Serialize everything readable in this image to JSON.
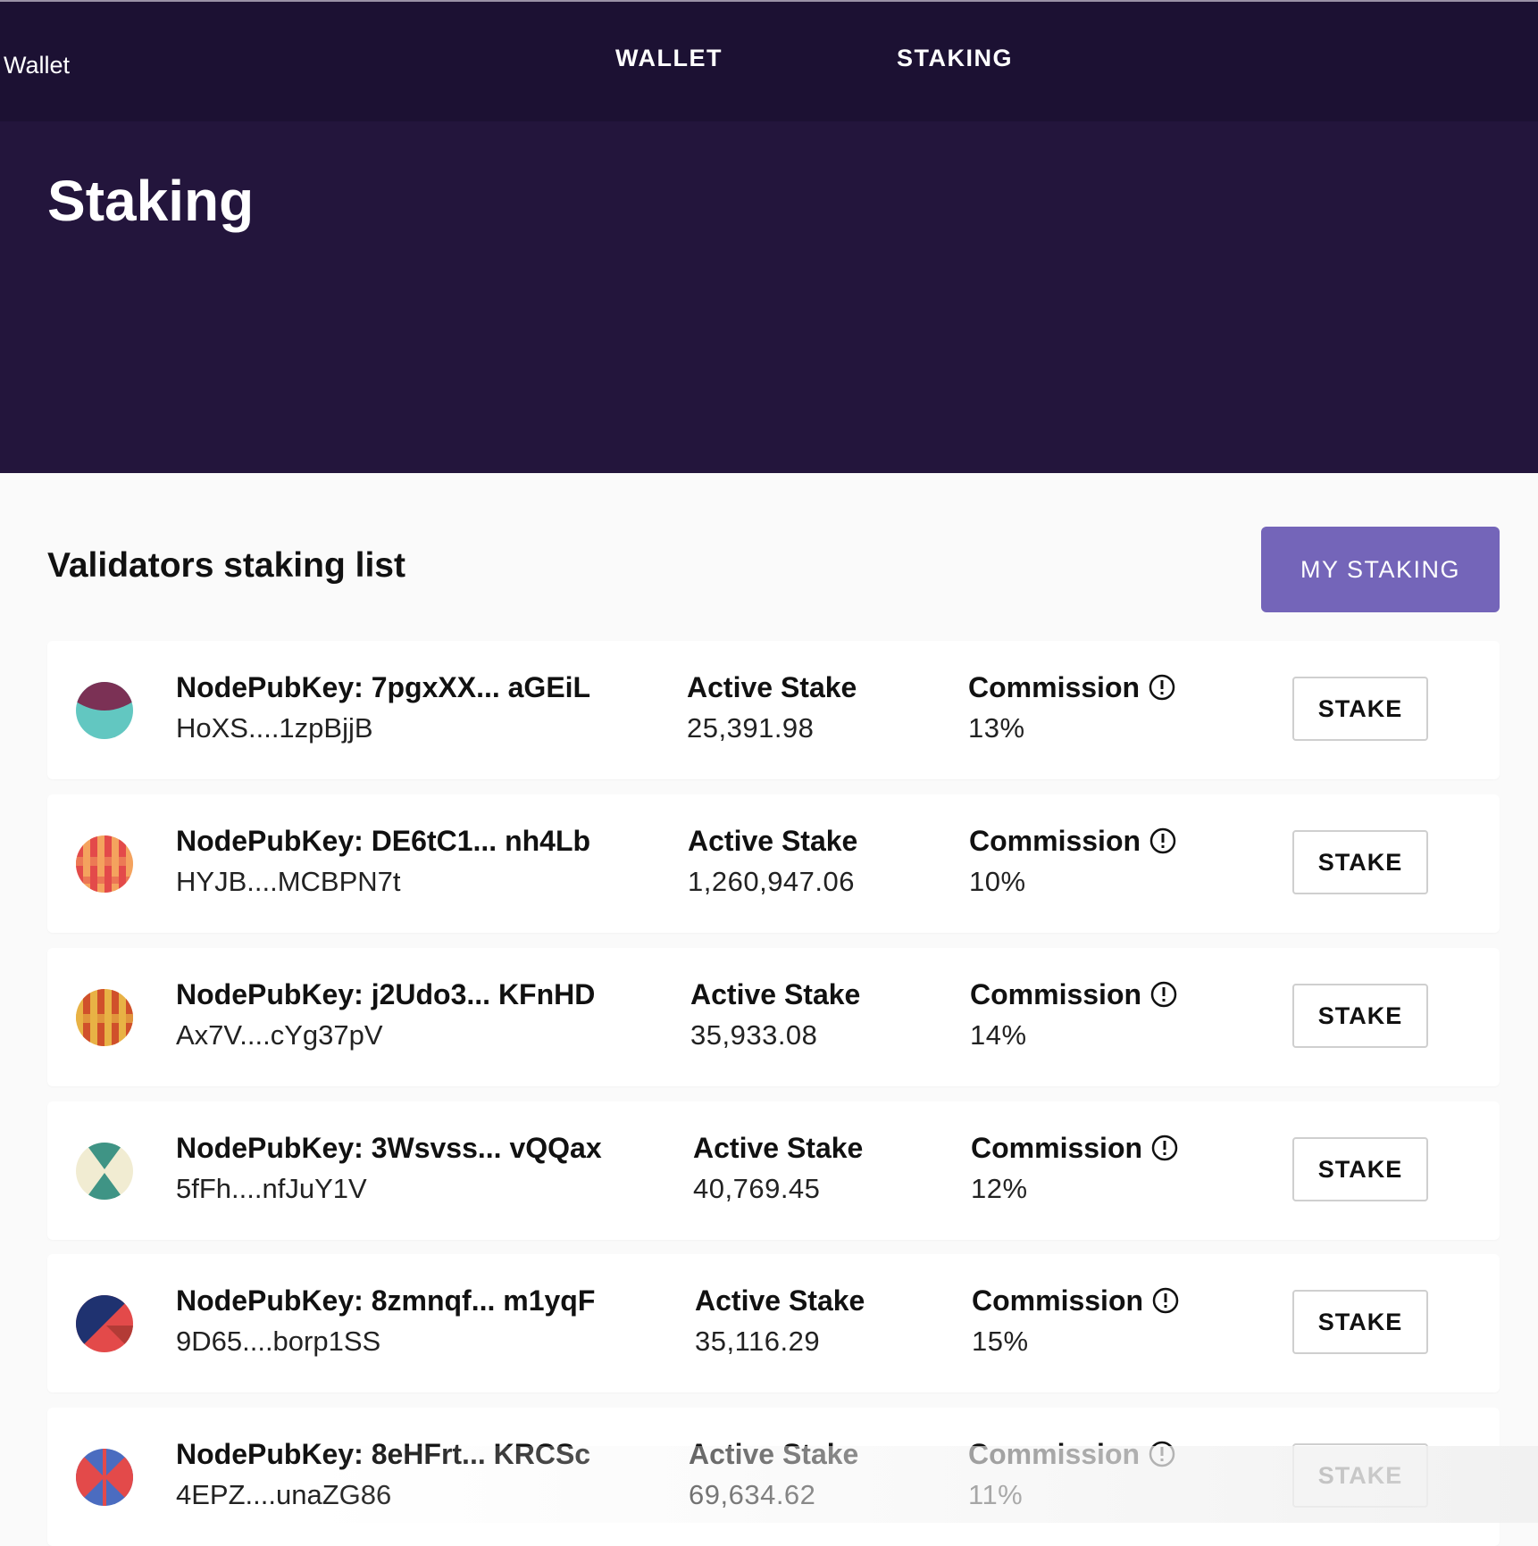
{
  "navbar": {
    "brand": "Wallet",
    "items": [
      {
        "label": "WALLET"
      },
      {
        "label": "STAKING"
      }
    ]
  },
  "hero": {
    "title": "Staking"
  },
  "list": {
    "title": "Validators staking list",
    "my_staking_label": "MY STAKING",
    "active_stake_label": "Active Stake",
    "commission_label": "Commission",
    "stake_button_label": "STAKE",
    "validators": [
      {
        "node_key": "NodePubKey: 7pgxXX... aGEiL",
        "address": "HoXS....1zpBjjB",
        "active_stake": "25,391.98",
        "commission": "13%",
        "avatar_icon": "half-circle-avatar-icon"
      },
      {
        "node_key": "NodePubKey: DE6tC1... nh4Lb",
        "address": "HYJB....MCBPN7t",
        "active_stake": "1,260,947.06",
        "commission": "10%",
        "avatar_icon": "striped-avatar-icon"
      },
      {
        "node_key": "NodePubKey: j2Udo3... KFnHD",
        "address": "Ax7V....cYg37pV",
        "active_stake": "35,933.08",
        "commission": "14%",
        "avatar_icon": "checkered-avatar-icon"
      },
      {
        "node_key": "NodePubKey: 3Wsvss... vQQax",
        "address": "5fFh....nfJuY1V",
        "active_stake": "40,769.45",
        "commission": "12%",
        "avatar_icon": "hourglass-avatar-icon"
      },
      {
        "node_key": "NodePubKey: 8zmnqf... m1yqF",
        "address": "9D65....borp1SS",
        "active_stake": "35,116.29",
        "commission": "15%",
        "avatar_icon": "diagonal-avatar-icon"
      },
      {
        "node_key": "NodePubKey: 8eHFrt... KRCSc",
        "address": "4EPZ....unaZG86",
        "active_stake": "69,634.62",
        "commission": "11%",
        "avatar_icon": "cross-avatar-icon"
      }
    ]
  },
  "colors": {
    "navbar_bg": "#1c1133",
    "hero_bg": "#23153c",
    "accent_button": "#7465b9",
    "page_bg": "#fafafa"
  }
}
